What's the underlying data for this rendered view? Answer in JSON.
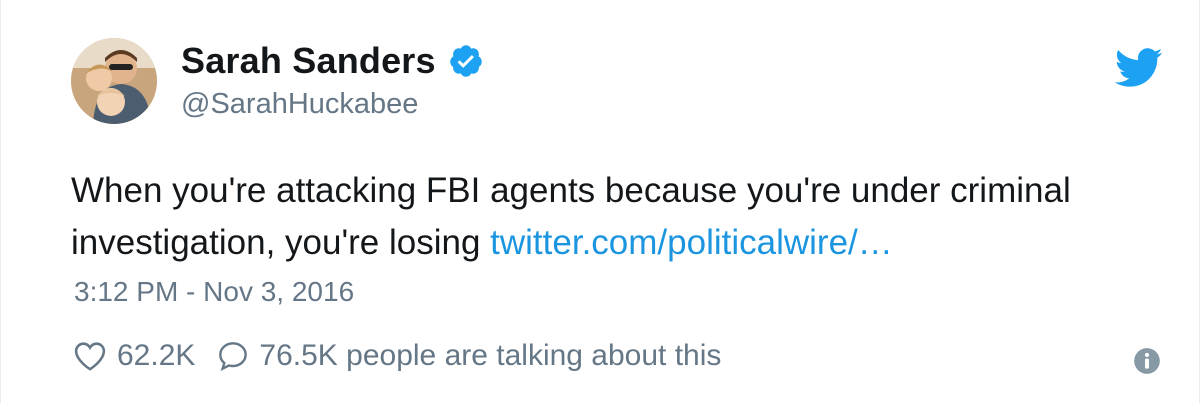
{
  "tweet": {
    "author_name": "Sarah Sanders",
    "handle": "@SarahHuckabee",
    "text": "When you're attacking FBI agents because you're under criminal investigation, you're losing ",
    "link_text": "twitter.com/politicalwire/…",
    "timestamp": "3:12 PM - Nov 3, 2016",
    "like_count": "62.2K",
    "talk_text": "76.5K people are talking about this"
  },
  "icons": {
    "verified": "verified-badge-icon",
    "brand": "twitter-bird-icon",
    "like": "heart-icon",
    "reply": "speech-bubble-icon",
    "info": "info-icon"
  },
  "colors": {
    "text": "#14171a",
    "secondary": "#657786",
    "link": "#1b95e0",
    "brand": "#1da1f2"
  }
}
